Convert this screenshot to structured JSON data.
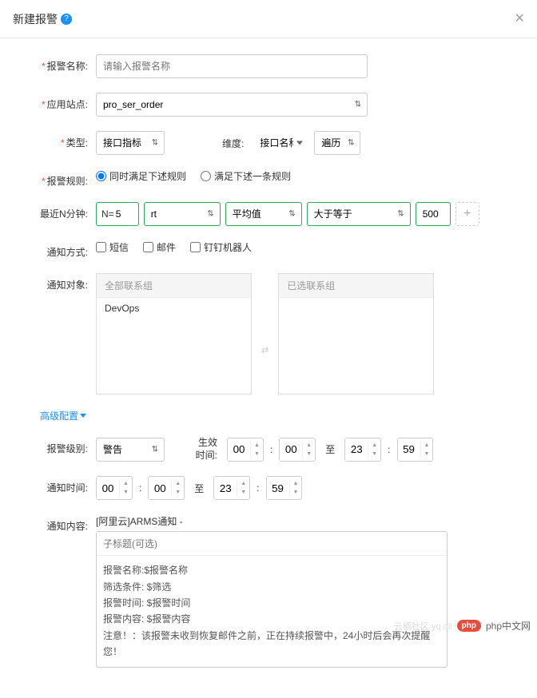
{
  "header": {
    "title": "新建报警"
  },
  "labels": {
    "alarm_name": "报警名称:",
    "app_site": "应用站点:",
    "type": "类型:",
    "dimension": "维度:",
    "alarm_rule": "报警规则:",
    "last_n": "最近N分钟:",
    "notify_method": "通知方式:",
    "notify_target": "通知对象:",
    "advanced": "高级配置",
    "alarm_level": "报警级别:",
    "effect_time": "生效时间:",
    "notify_time": "通知时间:",
    "notify_content": "通知内容:"
  },
  "fields": {
    "name_placeholder": "请输入报警名称",
    "app_site": "pro_ser_order",
    "type": "接口指标",
    "dimension_a": "接口名称",
    "dimension_b": "遍历",
    "rule_all": "同时满足下述规则",
    "rule_any": "满足下述一条规则",
    "n_prefix": "N=",
    "n_value": "5",
    "metric": "rt",
    "agg": "平均值",
    "op": "大于等于",
    "threshold": "500",
    "sms": "短信",
    "email": "邮件",
    "dingtalk": "钉钉机器人",
    "all_contacts": "全部联系组",
    "selected_contacts": "已选联系组",
    "contact_item": "DevOps",
    "level": "警告",
    "et_h1": "00",
    "et_m1": "00",
    "et_h2": "23",
    "et_m2": "59",
    "nt_h1": "00",
    "nt_m1": "00",
    "nt_h2": "23",
    "nt_m2": "59",
    "to": "至",
    "content_prefix": "[阿里云]ARMS通知 -",
    "subtitle_placeholder": "子标题(可选)",
    "body": "报警名称:$报警名称\n筛选条件: $筛选\n报警时间: $报警时间\n报警内容: $报警内容\n注意！：该报警未收到恢复邮件之前，正在持续报警中，24小时后会再次提醒您！"
  },
  "footer": {
    "watermark": "云栖社区 yq.ali",
    "brand": "php中文网",
    "badge": "php"
  }
}
